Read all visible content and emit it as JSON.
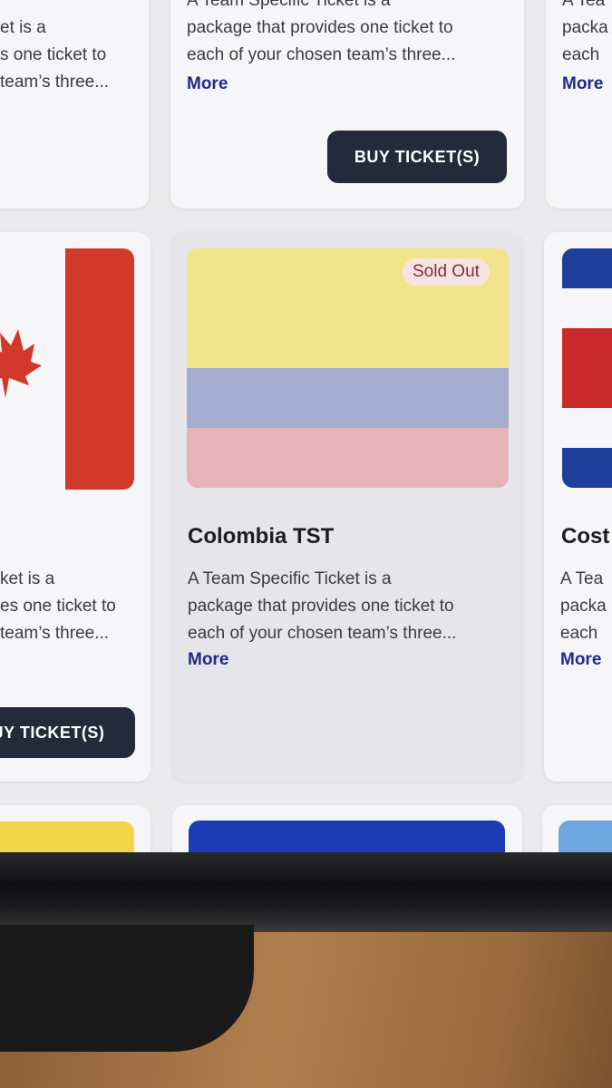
{
  "cards": {
    "top_left": {
      "desc_lines": [
        "et is a",
        "s one ticket to",
        "team’s three..."
      ]
    },
    "top_mid": {
      "desc_lines": [
        "A Team Specific Ticket is a",
        "package that provides one ticket to",
        "each of your chosen team’s three..."
      ],
      "more": "More",
      "button": "BUY TICKET(S)"
    },
    "top_right": {
      "desc_lines": [
        "A Tea",
        "packa",
        "each"
      ],
      "more": "More"
    },
    "mid_left": {
      "flag_icon": "canada-flag-icon",
      "desc_lines": [
        "ket is a",
        "es one ticket to",
        "team’s three..."
      ],
      "button": "JY TICKET(S)"
    },
    "mid_center": {
      "badge": "Sold Out",
      "flag_icon": "colombia-flag-icon",
      "title": "Colombia TST",
      "desc_lines": [
        "A Team Specific Ticket is a",
        "package that provides one ticket to",
        "each of your chosen team’s three..."
      ],
      "more": "More"
    },
    "mid_right": {
      "flag_icon": "costa-rica-flag-icon",
      "title": "Cost",
      "desc_lines": [
        "A Tea",
        "packa",
        "each"
      ],
      "more": "More"
    }
  },
  "colors": {
    "more_link": "#1f2a8a",
    "button_bg": "#232a3a",
    "colombia_yellow": "#f1e48a",
    "colombia_blue": "#a4adcf",
    "colombia_red": "#e6b4b8",
    "canada_red": "#d3392a"
  }
}
